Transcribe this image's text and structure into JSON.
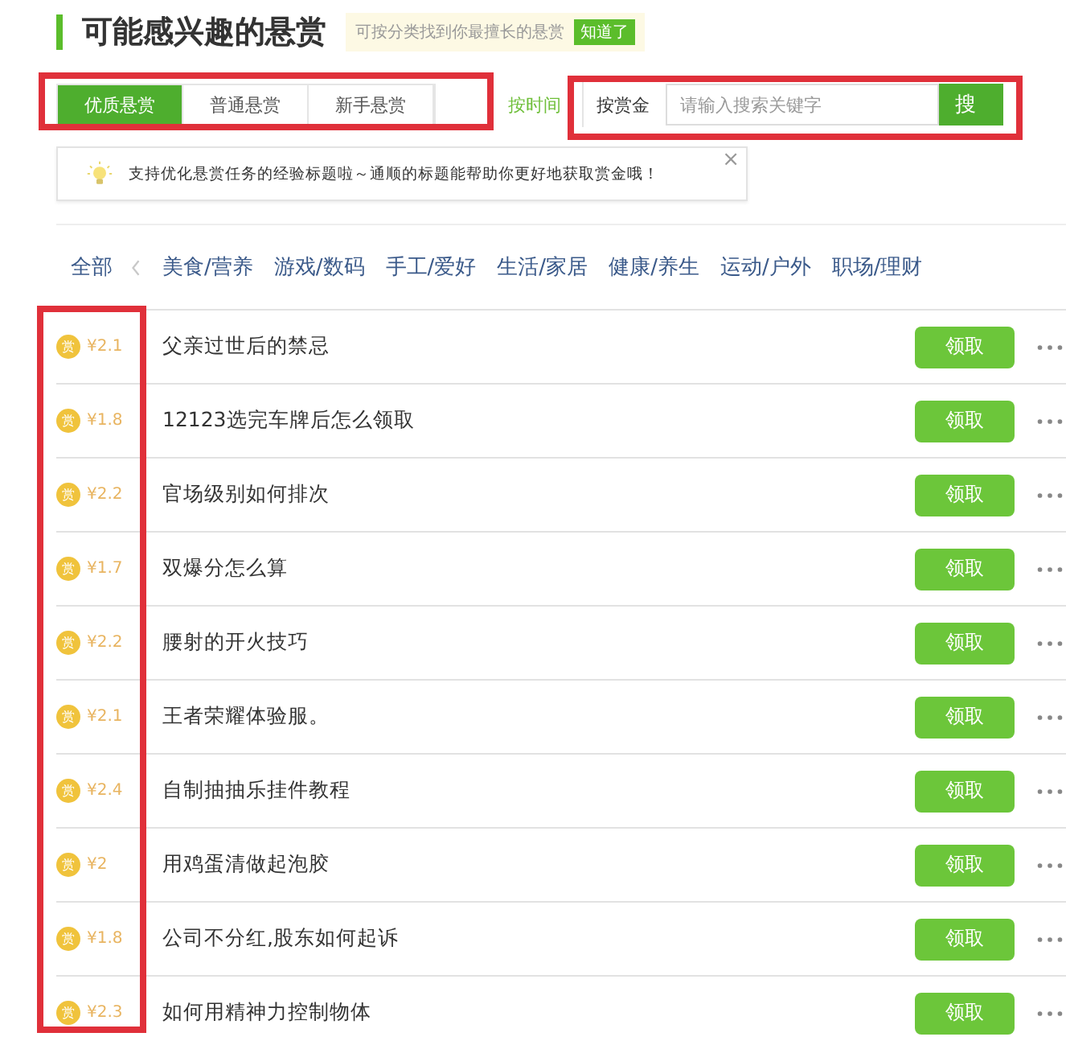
{
  "header": {
    "title": "可能感兴趣的悬赏",
    "hint": "可按分类找到你最擅长的悬赏",
    "hint_button": "知道了"
  },
  "tabs": {
    "highlighted": true,
    "items": [
      {
        "label": "优质悬赏",
        "selected": true
      },
      {
        "label": "普通悬赏",
        "selected": false
      },
      {
        "label": "新手悬赏",
        "selected": false
      }
    ]
  },
  "sort_link": "按时间",
  "search": {
    "highlighted": true,
    "label": "按赏金",
    "placeholder": "请输入搜索关键字",
    "button": "搜"
  },
  "tip": {
    "text": "支持优化悬赏任务的经验标题啦～通顺的标题能帮助你更好地获取赏金哦！",
    "close": "×"
  },
  "categories": [
    {
      "label": "全部",
      "selected": false
    },
    {
      "label": "美食/营养",
      "selected": false
    },
    {
      "label": "游戏/数码",
      "selected": false
    },
    {
      "label": "手工/爱好",
      "selected": false
    },
    {
      "label": "生活/家居",
      "selected": false
    },
    {
      "label": "健康/养生",
      "selected": false
    },
    {
      "label": "运动/户外",
      "selected": false
    },
    {
      "label": "职场/理财",
      "selected": false
    }
  ],
  "rewards_highlighted": true,
  "rows": [
    {
      "coin": "赏",
      "amount": "¥2.1",
      "title": "父亲过世后的禁忌",
      "button": "领取"
    },
    {
      "coin": "赏",
      "amount": "¥1.8",
      "title": "12123选完车牌后怎么领取",
      "button": "领取"
    },
    {
      "coin": "赏",
      "amount": "¥2.2",
      "title": "官场级别如何排次",
      "button": "领取"
    },
    {
      "coin": "赏",
      "amount": "¥1.7",
      "title": "双爆分怎么算",
      "button": "领取"
    },
    {
      "coin": "赏",
      "amount": "¥2.2",
      "title": "腰射的开火技巧",
      "button": "领取"
    },
    {
      "coin": "赏",
      "amount": "¥2.1",
      "title": "王者荣耀体验服。",
      "button": "领取"
    },
    {
      "coin": "赏",
      "amount": "¥2.4",
      "title": "自制抽抽乐挂件教程",
      "button": "领取"
    },
    {
      "coin": "赏",
      "amount": "¥2",
      "title": "用鸡蛋清做起泡胶",
      "button": "领取"
    },
    {
      "coin": "赏",
      "amount": "¥1.8",
      "title": "公司不分红,股东如何起诉",
      "button": "领取"
    },
    {
      "coin": "赏",
      "amount": "¥2.3",
      "title": "如何用精神力控制物体",
      "button": "领取"
    }
  ]
}
